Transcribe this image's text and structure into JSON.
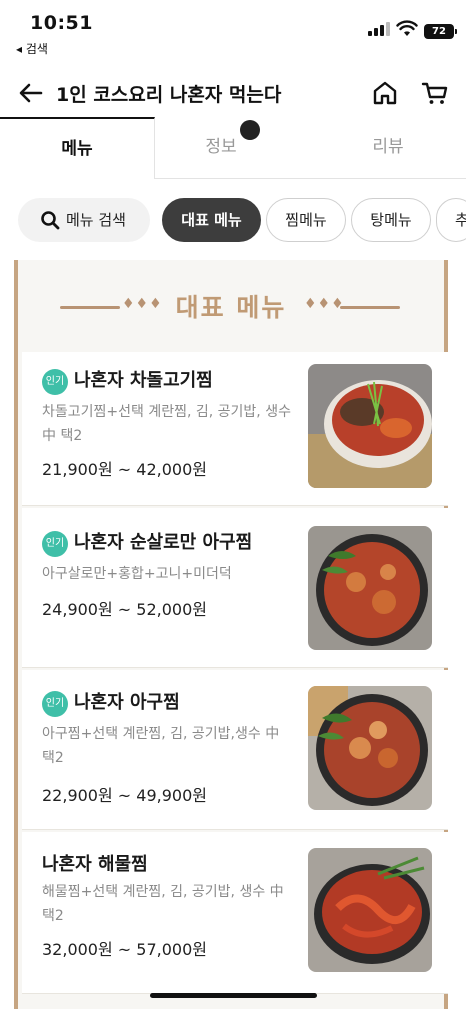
{
  "status_bar": {
    "time": "10:51",
    "back_app": "◂ 검색",
    "battery": "72"
  },
  "header": {
    "title": "1인 코스요리 나혼자 먹는다"
  },
  "tabs": [
    {
      "label": "메뉴",
      "active": true
    },
    {
      "label": "정보",
      "active": false
    },
    {
      "label": "리뷰",
      "active": false
    }
  ],
  "chips": {
    "search_label": "메뉴 검색",
    "items": [
      {
        "label": "대표 메뉴",
        "active": true
      },
      {
        "label": "찜메뉴",
        "active": false
      },
      {
        "label": "탕메뉴",
        "active": false
      },
      {
        "label": "추",
        "active": false
      }
    ]
  },
  "section": {
    "title": "대표 메뉴"
  },
  "menu_items": [
    {
      "badge": "인기",
      "name": "나혼자 차돌고기찜",
      "desc": "차돌고기찜+선택 계란찜, 김, 공기밥, 생수 中 택2",
      "price": "21,900원 ~ 42,000원"
    },
    {
      "badge": "인기",
      "name": "나혼자 순살로만 아구찜",
      "desc": "아구살로만+홍합+고니+미더덕",
      "price": "24,900원 ~ 52,000원"
    },
    {
      "badge": "인기",
      "name": "나혼자 아구찜",
      "desc": "아구찜+선택 계란찜, 김, 공기밥,생수 中 택2",
      "price": "22,900원 ~ 49,900원"
    },
    {
      "badge": "",
      "name": "나혼자 해물찜",
      "desc": "해물찜+선택 계란찜, 김, 공기밥, 생수 中 택2",
      "price": "32,000원 ~ 57,000원"
    }
  ],
  "colors": {
    "accent_gold": "#c09a74",
    "badge_teal": "#3fbfa8",
    "active_chip": "#3d3d3d"
  }
}
